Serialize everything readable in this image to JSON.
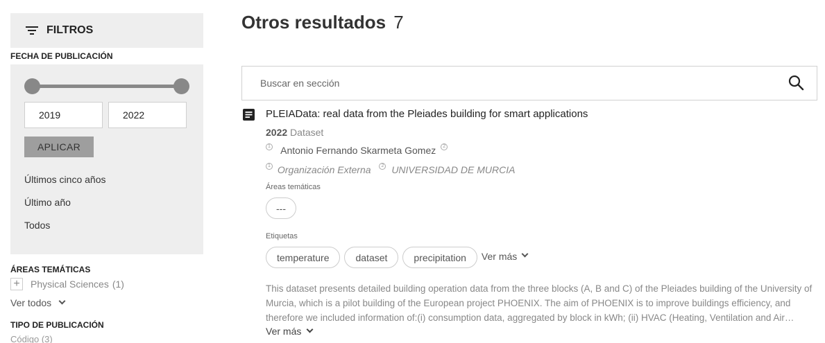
{
  "sidebar": {
    "filters_title": "FILTROS",
    "date_section_label": "FECHA DE PUBLICACIÓN",
    "year_from": "2019",
    "year_to": "2022",
    "apply_label": "APLICAR",
    "quick_links": [
      "Últimos cinco años",
      "Último año",
      "Todos"
    ],
    "areas_label": "ÁREAS TEMÁTICAS",
    "area_item": "Physical Sciences",
    "area_count": "(1)",
    "see_all": "Ver todos",
    "pub_type_label": "TIPO DE PUBLICACIÓN",
    "pub_type_item": "Código",
    "pub_type_count": "(3)"
  },
  "main": {
    "results_title": "Otros resultados",
    "results_count": "7",
    "search_placeholder": "Buscar en sección",
    "result": {
      "title": "PLEIAData: real data from the Pleiades building for smart applications",
      "year": "2022",
      "type": "Dataset",
      "author_marker": "1",
      "author": "Antonio Fernando Skarmeta Gomez",
      "author_affil_marker": "2",
      "org1_marker": "1",
      "org1": "Organización Externa",
      "org2_marker": "2",
      "org2": "UNIVERSIDAD DE MURCIA",
      "areas_label": "Áreas temáticas",
      "areas_chip": "---",
      "tags_label": "Etiquetas",
      "tags": [
        "temperature",
        "dataset",
        "precipitation"
      ],
      "tags_more": "Ver más",
      "description": "This dataset presents detailed building operation data from the three blocks (A, B and C) of the Pleiades building of the University of Murcia, which is a pilot building of the European project PHOENIX. The aim of PHOENIX is to improve buildings efficiency, and therefore we included information of:(i) consumption data, aggregated by block in kWh; (ii) HVAC (Heating, Ventilation and Air…",
      "description_more": "Ver más"
    }
  }
}
